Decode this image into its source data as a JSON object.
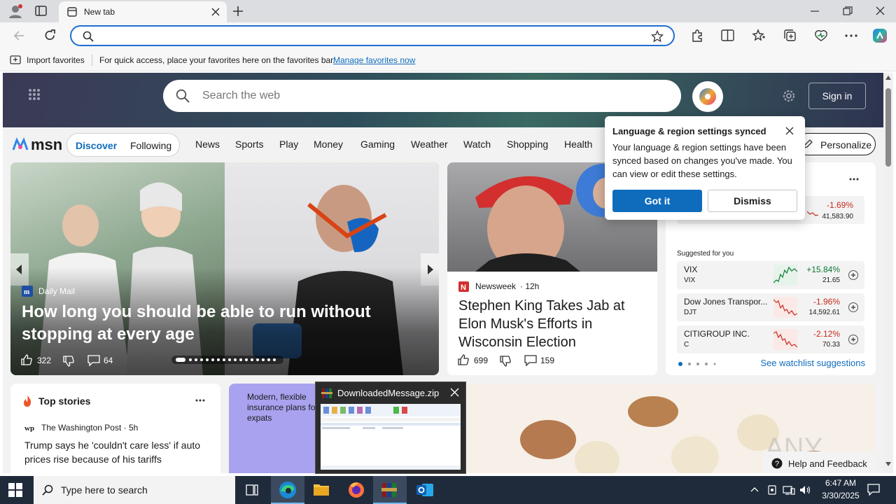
{
  "browser": {
    "tab_title": "New tab",
    "address_placeholder": "",
    "favbar": {
      "import_label": "Import favorites",
      "hint": "For quick access, place your favorites here on the favorites bar.",
      "manage_link": "Manage favorites now"
    }
  },
  "msn": {
    "search_placeholder": "Search the web",
    "sign_in": "Sign in",
    "logo": "msn",
    "pill_tabs": [
      "Discover",
      "Following"
    ],
    "nav": [
      "News",
      "Sports",
      "Play",
      "Money",
      "Gaming",
      "Weather",
      "Watch",
      "Shopping",
      "Health"
    ],
    "personalize": "Personalize"
  },
  "hero": {
    "source": "Daily Mail",
    "headline": "How long you should be able to run without stopping at every age",
    "likes": "322",
    "comments": "64"
  },
  "card2": {
    "source": "Newsweek",
    "age": "· 12h",
    "headline": "Stephen King Takes Jab at Elon Musk's Efforts in Wisconsin Election",
    "likes": "699",
    "comments": "159"
  },
  "popup": {
    "title": "Language & region settings synced",
    "body": "Your language & region settings have been synced based on changes you've made. You can view or edit these settings.",
    "primary": "Got it",
    "secondary": "Dismiss"
  },
  "market": {
    "top_change": "-1.69%",
    "top_value": "41,583.90",
    "suggested_label": "Suggested for you",
    "rows": [
      {
        "name": "VIX",
        "symbol": "VIX",
        "change": "+15.84%",
        "price": "21.65",
        "color": "#0a7a32"
      },
      {
        "name": "Dow Jones Transpor...",
        "symbol": "DJT",
        "change": "-1.96%",
        "price": "14,592.61",
        "color": "#c42b1c"
      },
      {
        "name": "CITIGROUP INC.",
        "symbol": "C",
        "change": "-2.12%",
        "price": "70.33",
        "color": "#c42b1c"
      }
    ],
    "watchlist_link": "See watchlist suggestions"
  },
  "top_stories": {
    "title": "Top stories",
    "source": "The Washington Post · 5h",
    "headline": "Trump says he 'couldn't care less' if auto prices rise because of his tariffs"
  },
  "ad": {
    "text": "Modern, flexible insurance plans for expats"
  },
  "thumbnail": {
    "title": "DownloadedMessage.zip"
  },
  "feedback": "Help and Feedback",
  "watermark": "ANY RUN",
  "taskbar": {
    "search_placeholder": "Type here to search",
    "time": "6:47 AM",
    "date": "3/30/2025"
  },
  "colors": {
    "accent": "#0f6cbd",
    "up": "#0a7a32",
    "down": "#c42b1c"
  }
}
